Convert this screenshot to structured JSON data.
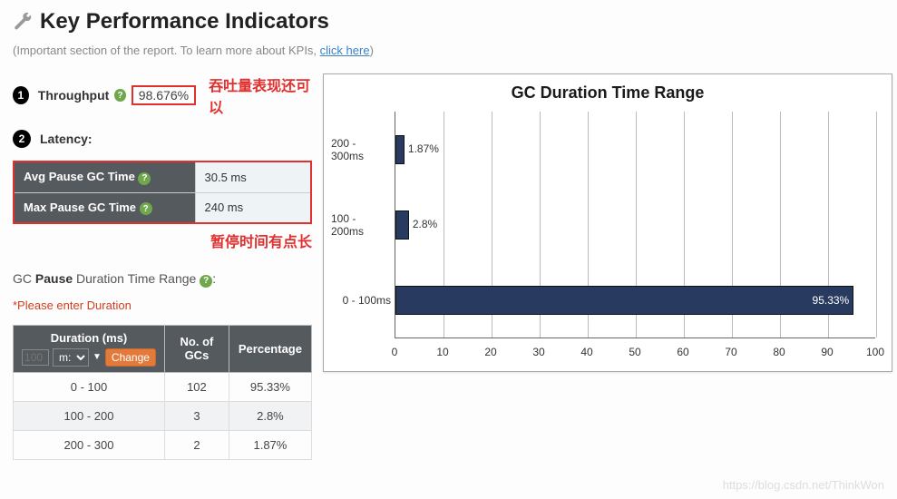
{
  "header": {
    "title": "Key Performance Indicators",
    "subtitle_prefix": "(Important section of the report. To learn more about KPIs, ",
    "subtitle_link": "click here",
    "subtitle_suffix": ")"
  },
  "kpi": {
    "throughput_label": "Throughput",
    "throughput_value": "98.676%",
    "throughput_note": "吞吐量表现还可以",
    "latency_label": "Latency:"
  },
  "latency_table": {
    "rows": [
      {
        "label": "Avg Pause GC Time",
        "value": "30.5 ms"
      },
      {
        "label": "Max Pause GC Time",
        "value": "240 ms"
      }
    ],
    "note": "暂停时间有点长"
  },
  "duration_section": {
    "heading_prefix": "GC ",
    "heading_bold": "Pause",
    "heading_suffix": " Duration Time Range ",
    "error": "*Please enter Duration"
  },
  "duration_table": {
    "col_duration": "Duration (ms)",
    "col_gcs": "No. of GCs",
    "col_pct": "Percentage",
    "input_placeholder": "100",
    "select_value": "m:",
    "change_btn": "Change",
    "rows": [
      {
        "range": "0 - 100",
        "gcs": "102",
        "pct": "95.33%"
      },
      {
        "range": "100 - 200",
        "gcs": "3",
        "pct": "2.8%"
      },
      {
        "range": "200 - 300",
        "gcs": "2",
        "pct": "1.87%"
      }
    ]
  },
  "chart_data": {
    "type": "bar",
    "title": "GC Duration Time Range",
    "orientation": "horizontal",
    "categories": [
      "0 - 100ms",
      "100 - 200ms",
      "200 - 300ms"
    ],
    "values": [
      95.33,
      2.8,
      1.87
    ],
    "labels": [
      "95.33%",
      "2.8%",
      "1.87%"
    ],
    "xlabel": "",
    "ylabel": "",
    "xlim": [
      0,
      100
    ],
    "xticks": [
      0,
      10,
      20,
      30,
      40,
      50,
      60,
      70,
      80,
      90,
      100
    ]
  },
  "watermark": "https://blog.csdn.net/ThinkWon"
}
